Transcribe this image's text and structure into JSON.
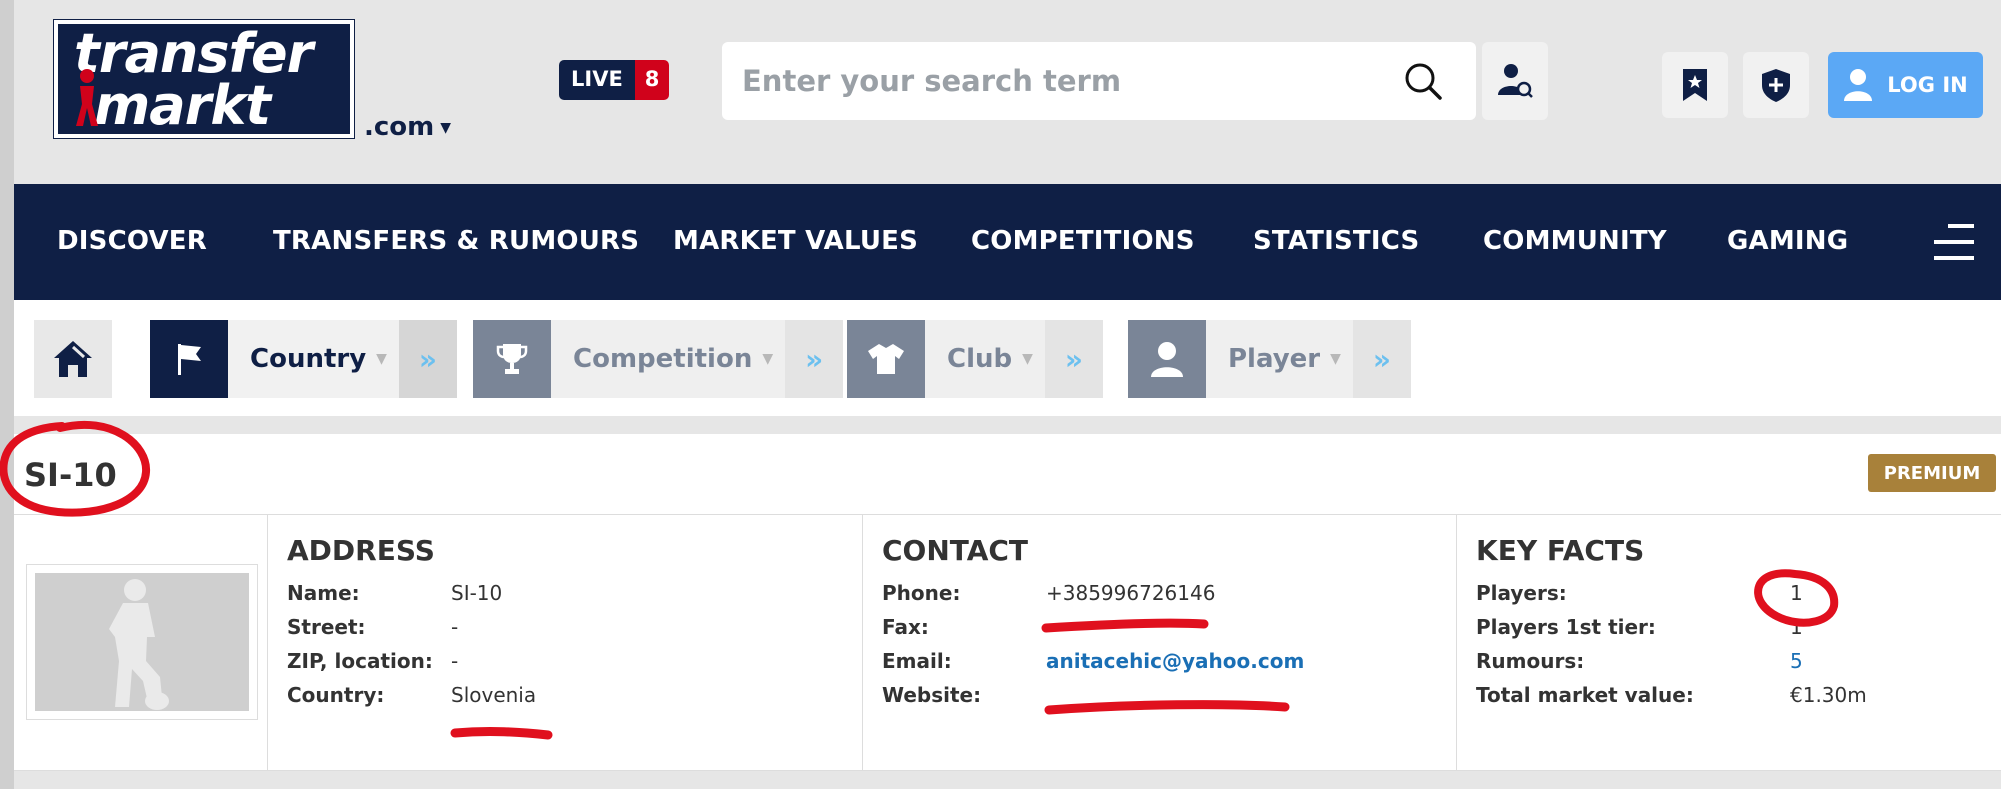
{
  "header": {
    "logo_line1": "transfer",
    "logo_line2": "markt",
    "domain": ".com",
    "live_label": "LIVE",
    "live_count": "8",
    "search_placeholder": "Enter your search term",
    "login_label": "LOG IN"
  },
  "nav": {
    "items": [
      "DISCOVER",
      "TRANSFERS & RUMOURS",
      "MARKET VALUES",
      "COMPETITIONS",
      "STATISTICS",
      "COMMUNITY",
      "GAMING"
    ]
  },
  "breadcrumb": {
    "items": [
      {
        "label": "Country",
        "icon": "flag-icon",
        "state": "active"
      },
      {
        "label": "Competition",
        "icon": "trophy-icon",
        "state": "inactive"
      },
      {
        "label": "Club",
        "icon": "shirt-icon",
        "state": "inactive"
      },
      {
        "label": "Player",
        "icon": "person-icon",
        "state": "inactive"
      }
    ]
  },
  "profile": {
    "title": "SI-10",
    "premium": "PREMIUM"
  },
  "address": {
    "heading": "ADDRESS",
    "rows": [
      {
        "label": "Name:",
        "value": "SI-10"
      },
      {
        "label": "Street:",
        "value": "-"
      },
      {
        "label": "ZIP, location:",
        "value": "-"
      },
      {
        "label": "Country:",
        "value": "Slovenia"
      }
    ]
  },
  "contact": {
    "heading": "CONTACT",
    "rows": [
      {
        "label": "Phone:",
        "value": "+385996726146"
      },
      {
        "label": "Fax:",
        "value": "-"
      },
      {
        "label": "Email:",
        "value": "anitacehic@yahoo.com"
      },
      {
        "label": "Website:",
        "value": ""
      }
    ]
  },
  "key_facts": {
    "heading": "KEY FACTS",
    "rows": [
      {
        "label": "Players:",
        "value": "1"
      },
      {
        "label": "Players 1st tier:",
        "value": "1"
      },
      {
        "label": "Rumours:",
        "value": "5"
      },
      {
        "label": "Total market value:",
        "value": "€1.30m"
      }
    ]
  },
  "colors": {
    "navy": "#0f1f45",
    "live_red": "#d0021b",
    "login_blue": "#5ba8f5",
    "premium_gold": "#a8813a",
    "annotation_red": "#e0101e"
  }
}
